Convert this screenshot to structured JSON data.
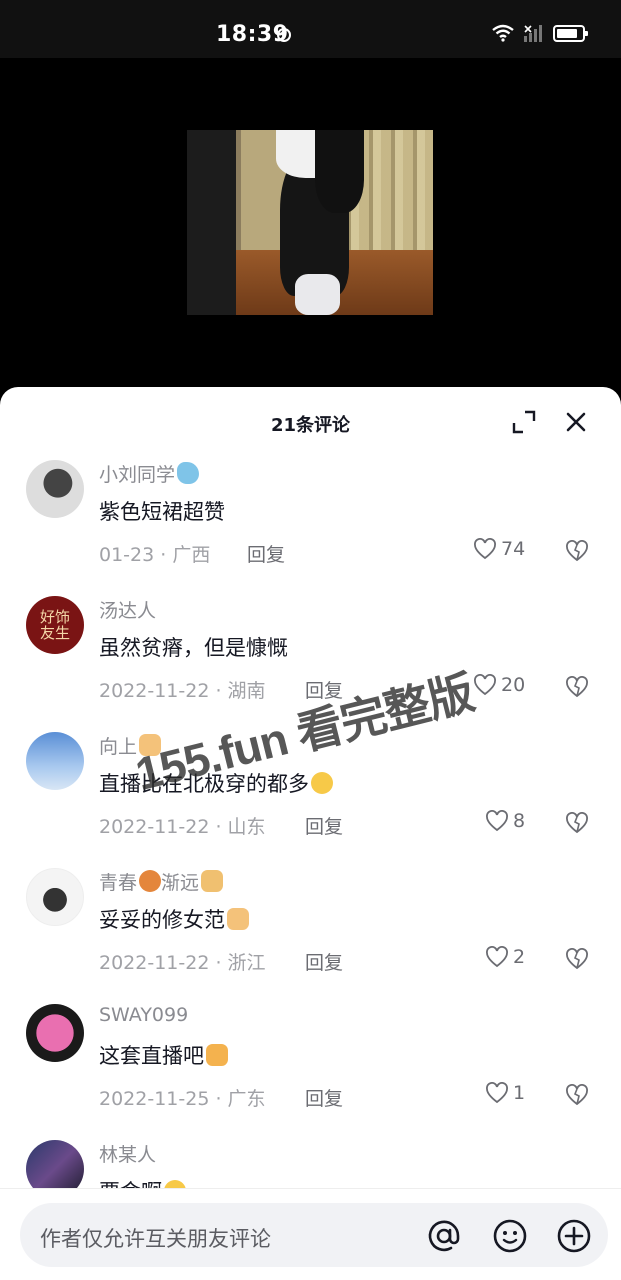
{
  "status_bar": {
    "time": "18:39"
  },
  "sheet": {
    "title": "21条评论"
  },
  "comments": [
    {
      "username": "小刘同学",
      "text": "紫色短裙超赞",
      "meta": "01-23 · 广西",
      "reply": "回复",
      "likes": "74",
      "avatar_color": "#d9d9d9"
    },
    {
      "username": "汤达人",
      "text": "虽然贫瘠，但是慷慨",
      "meta": "2022-11-22 · 湖南",
      "reply": "回复",
      "likes": "20",
      "avatar_text": "好饰友生"
    },
    {
      "username": "向上",
      "text": "直播比在北极穿的都多",
      "meta": "2022-11-22 · 山东",
      "reply": "回复",
      "likes": "8"
    },
    {
      "username": "青春",
      "username_suffix": "渐远",
      "text": "妥妥的修女范",
      "meta": "2022-11-22 · 浙江",
      "reply": "回复",
      "likes": "2"
    },
    {
      "username": "SWAY099",
      "text": "这套直播吧",
      "meta": "2022-11-25 · 广东",
      "reply": "回复",
      "likes": "1"
    },
    {
      "username": "林某人",
      "text": "要命啊"
    }
  ],
  "watermark": "155.fun 看完整版",
  "input": {
    "placeholder": "作者仅允许互关朋友评论"
  },
  "colors": {
    "sheet_bg": "#ffffff",
    "text_primary": "#161823",
    "text_secondary": "#8a8b91",
    "input_bg": "#f1f2f5"
  }
}
